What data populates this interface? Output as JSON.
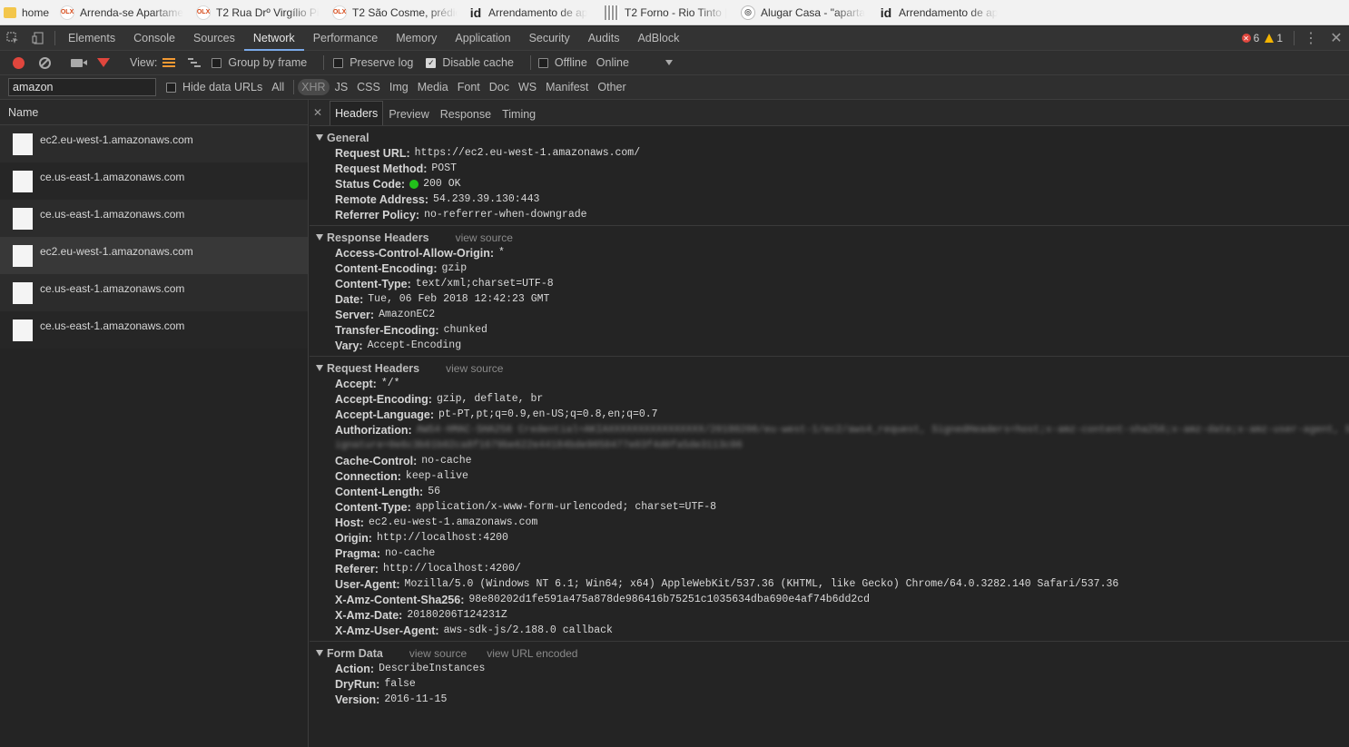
{
  "bookmarks": [
    {
      "label": "home",
      "icon": "folder-icon"
    },
    {
      "label": "Arrenda-se Apartame",
      "icon": "olx-icon"
    },
    {
      "label": "T2 Rua Drº Virgílio Pi",
      "icon": "olx-icon"
    },
    {
      "label": "T2 São Cosme, prédio",
      "icon": "olx-icon"
    },
    {
      "label": "Arrendamento de ap",
      "icon": "id-icon"
    },
    {
      "label": "T2 Forno - Rio Tinto |",
      "icon": "stripe-icon"
    },
    {
      "label": "Alugar Casa - \"aparta",
      "icon": "site-icon"
    },
    {
      "label": "Arrendamento de ap",
      "icon": "id-icon"
    }
  ],
  "devtools": {
    "tabs": [
      "Elements",
      "Console",
      "Sources",
      "Network",
      "Performance",
      "Memory",
      "Application",
      "Security",
      "Audits",
      "AdBlock"
    ],
    "active_tab": "Network",
    "error_count": "6",
    "warning_count": "1"
  },
  "toolbar": {
    "view_label": "View:",
    "group_by_frame": "Group by frame",
    "preserve_log": "Preserve log",
    "disable_cache": "Disable cache",
    "offline": "Offline",
    "throttle": "Online"
  },
  "filter": {
    "value": "amazon",
    "hide_data_urls": "Hide data URLs",
    "types": [
      "All",
      "XHR",
      "JS",
      "CSS",
      "Img",
      "Media",
      "Font",
      "Doc",
      "WS",
      "Manifest",
      "Other"
    ],
    "active_type": "XHR"
  },
  "requests": {
    "column": "Name",
    "items": [
      "ec2.eu-west-1.amazonaws.com",
      "ce.us-east-1.amazonaws.com",
      "ce.us-east-1.amazonaws.com",
      "ec2.eu-west-1.amazonaws.com",
      "ce.us-east-1.amazonaws.com",
      "ce.us-east-1.amazonaws.com"
    ]
  },
  "detail": {
    "tabs": [
      "Headers",
      "Preview",
      "Response",
      "Timing"
    ],
    "active_tab": "Headers",
    "general": {
      "title": "General",
      "rows": [
        {
          "k": "Request URL:",
          "v": "https://ec2.eu-west-1.amazonaws.com/"
        },
        {
          "k": "Request Method:",
          "v": "POST"
        },
        {
          "k": "Status Code:",
          "v": "200 OK"
        },
        {
          "k": "Remote Address:",
          "v": "54.239.39.130:443"
        },
        {
          "k": "Referrer Policy:",
          "v": "no-referrer-when-downgrade"
        }
      ]
    },
    "response_headers": {
      "title": "Response Headers",
      "view_source": "view source",
      "rows": [
        {
          "k": "Access-Control-Allow-Origin:",
          "v": "*"
        },
        {
          "k": "Content-Encoding:",
          "v": "gzip"
        },
        {
          "k": "Content-Type:",
          "v": "text/xml;charset=UTF-8"
        },
        {
          "k": "Date:",
          "v": "Tue, 06 Feb 2018 12:42:23 GMT"
        },
        {
          "k": "Server:",
          "v": "AmazonEC2"
        },
        {
          "k": "Transfer-Encoding:",
          "v": "chunked"
        },
        {
          "k": "Vary:",
          "v": "Accept-Encoding"
        }
      ]
    },
    "request_headers": {
      "title": "Request Headers",
      "view_source": "view source",
      "rows_before": [
        {
          "k": "Accept:",
          "v": "*/*"
        },
        {
          "k": "Accept-Encoding:",
          "v": "gzip, deflate, br"
        },
        {
          "k": "Accept-Language:",
          "v": "pt-PT,pt;q=0.9,en-US;q=0.8,en;q=0.7"
        }
      ],
      "authorization": {
        "k": "Authorization:",
        "v1": "AWS4-HMAC-SHA256 Credential=AKIAXXXXXXXXXXXXXXXX/20180206/eu-west-1/ec2/aws4_request, SignedHeaders=host;x-amz-content-sha256;x-amz-date;x-amz-user-agent, S",
        "v2": "ignature=0e6c3b61b02ca8f1679be622e44184bde9050477e03f4d0fa5de3113c06"
      },
      "rows_after": [
        {
          "k": "Cache-Control:",
          "v": "no-cache"
        },
        {
          "k": "Connection:",
          "v": "keep-alive"
        },
        {
          "k": "Content-Length:",
          "v": "56"
        },
        {
          "k": "Content-Type:",
          "v": "application/x-www-form-urlencoded; charset=UTF-8"
        },
        {
          "k": "Host:",
          "v": "ec2.eu-west-1.amazonaws.com"
        },
        {
          "k": "Origin:",
          "v": "http://localhost:4200"
        },
        {
          "k": "Pragma:",
          "v": "no-cache"
        },
        {
          "k": "Referer:",
          "v": "http://localhost:4200/"
        },
        {
          "k": "User-Agent:",
          "v": "Mozilla/5.0 (Windows NT 6.1; Win64; x64) AppleWebKit/537.36 (KHTML, like Gecko) Chrome/64.0.3282.140 Safari/537.36"
        },
        {
          "k": "X-Amz-Content-Sha256:",
          "v": "98e80202d1fe591a475a878de986416b75251c1035634dba690e4af74b6dd2cd"
        },
        {
          "k": "X-Amz-Date:",
          "v": "20180206T124231Z"
        },
        {
          "k": "X-Amz-User-Agent:",
          "v": "aws-sdk-js/2.188.0 callback"
        }
      ]
    },
    "form_data": {
      "title": "Form Data",
      "view_source": "view source",
      "view_url_encoded": "view URL encoded",
      "rows": [
        {
          "k": "Action:",
          "v": "DescribeInstances"
        },
        {
          "k": "DryRun:",
          "v": "false"
        },
        {
          "k": "Version:",
          "v": "2016-11-15"
        }
      ]
    }
  },
  "colors": {
    "record": "#e0463d",
    "status_ok": "#22c11b",
    "active_tab_underline": "#7aa9e8",
    "warning": "#f4b400"
  }
}
